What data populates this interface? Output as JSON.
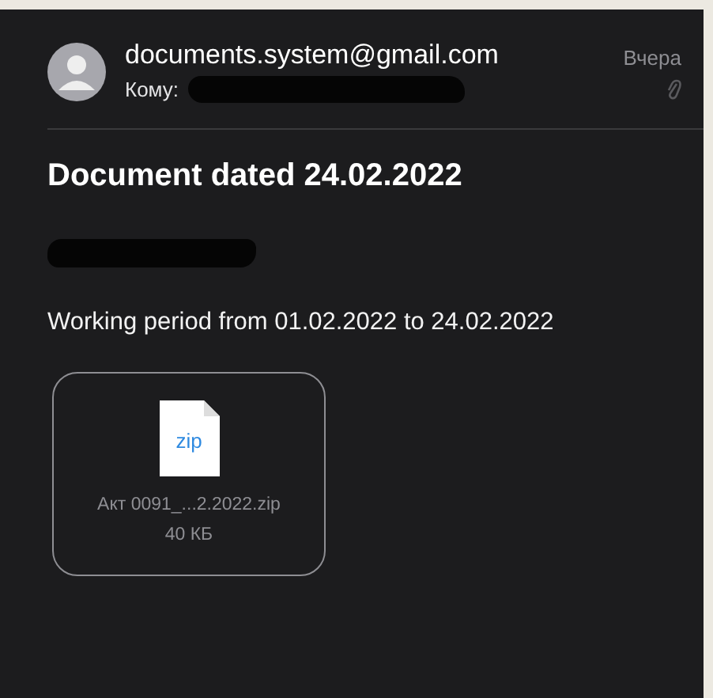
{
  "message": {
    "sender": "documents.system@gmail.com",
    "to_label": "Кому:",
    "to_redacted": true,
    "date": "Вчера",
    "has_attachment": true
  },
  "subject": "Document dated 24.02.2022",
  "greeting_redacted": true,
  "body": "Working period from 01.02.2022 to 24.02.2022",
  "attachments": [
    {
      "kind": "zip",
      "icon_text": "zip",
      "name": "Акт 0091_...2.2022.zip",
      "size": "40 КБ"
    }
  ]
}
